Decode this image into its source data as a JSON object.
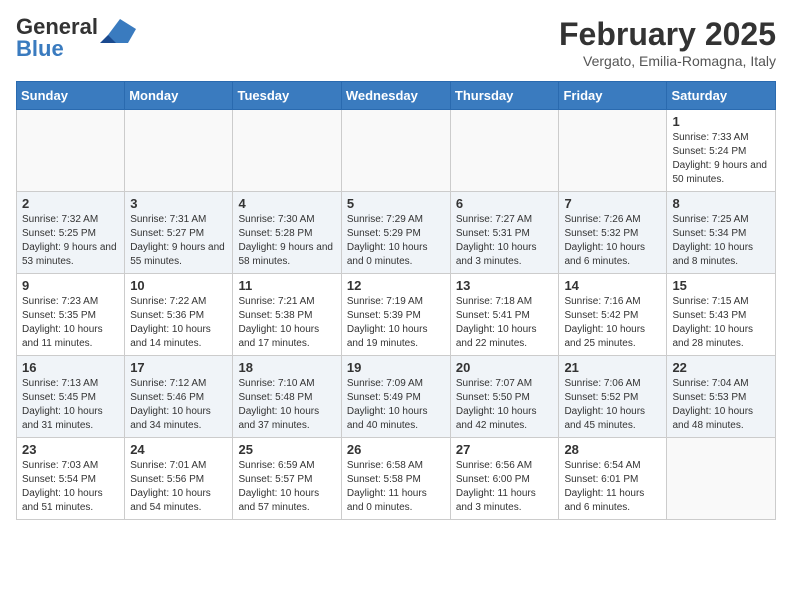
{
  "header": {
    "logo_general": "General",
    "logo_blue": "Blue",
    "month_year": "February 2025",
    "location": "Vergato, Emilia-Romagna, Italy"
  },
  "days_of_week": [
    "Sunday",
    "Monday",
    "Tuesday",
    "Wednesday",
    "Thursday",
    "Friday",
    "Saturday"
  ],
  "weeks": [
    {
      "alt": false,
      "days": [
        {
          "num": "",
          "info": ""
        },
        {
          "num": "",
          "info": ""
        },
        {
          "num": "",
          "info": ""
        },
        {
          "num": "",
          "info": ""
        },
        {
          "num": "",
          "info": ""
        },
        {
          "num": "",
          "info": ""
        },
        {
          "num": "1",
          "info": "Sunrise: 7:33 AM\nSunset: 5:24 PM\nDaylight: 9 hours and 50 minutes."
        }
      ]
    },
    {
      "alt": true,
      "days": [
        {
          "num": "2",
          "info": "Sunrise: 7:32 AM\nSunset: 5:25 PM\nDaylight: 9 hours and 53 minutes."
        },
        {
          "num": "3",
          "info": "Sunrise: 7:31 AM\nSunset: 5:27 PM\nDaylight: 9 hours and 55 minutes."
        },
        {
          "num": "4",
          "info": "Sunrise: 7:30 AM\nSunset: 5:28 PM\nDaylight: 9 hours and 58 minutes."
        },
        {
          "num": "5",
          "info": "Sunrise: 7:29 AM\nSunset: 5:29 PM\nDaylight: 10 hours and 0 minutes."
        },
        {
          "num": "6",
          "info": "Sunrise: 7:27 AM\nSunset: 5:31 PM\nDaylight: 10 hours and 3 minutes."
        },
        {
          "num": "7",
          "info": "Sunrise: 7:26 AM\nSunset: 5:32 PM\nDaylight: 10 hours and 6 minutes."
        },
        {
          "num": "8",
          "info": "Sunrise: 7:25 AM\nSunset: 5:34 PM\nDaylight: 10 hours and 8 minutes."
        }
      ]
    },
    {
      "alt": false,
      "days": [
        {
          "num": "9",
          "info": "Sunrise: 7:23 AM\nSunset: 5:35 PM\nDaylight: 10 hours and 11 minutes."
        },
        {
          "num": "10",
          "info": "Sunrise: 7:22 AM\nSunset: 5:36 PM\nDaylight: 10 hours and 14 minutes."
        },
        {
          "num": "11",
          "info": "Sunrise: 7:21 AM\nSunset: 5:38 PM\nDaylight: 10 hours and 17 minutes."
        },
        {
          "num": "12",
          "info": "Sunrise: 7:19 AM\nSunset: 5:39 PM\nDaylight: 10 hours and 19 minutes."
        },
        {
          "num": "13",
          "info": "Sunrise: 7:18 AM\nSunset: 5:41 PM\nDaylight: 10 hours and 22 minutes."
        },
        {
          "num": "14",
          "info": "Sunrise: 7:16 AM\nSunset: 5:42 PM\nDaylight: 10 hours and 25 minutes."
        },
        {
          "num": "15",
          "info": "Sunrise: 7:15 AM\nSunset: 5:43 PM\nDaylight: 10 hours and 28 minutes."
        }
      ]
    },
    {
      "alt": true,
      "days": [
        {
          "num": "16",
          "info": "Sunrise: 7:13 AM\nSunset: 5:45 PM\nDaylight: 10 hours and 31 minutes."
        },
        {
          "num": "17",
          "info": "Sunrise: 7:12 AM\nSunset: 5:46 PM\nDaylight: 10 hours and 34 minutes."
        },
        {
          "num": "18",
          "info": "Sunrise: 7:10 AM\nSunset: 5:48 PM\nDaylight: 10 hours and 37 minutes."
        },
        {
          "num": "19",
          "info": "Sunrise: 7:09 AM\nSunset: 5:49 PM\nDaylight: 10 hours and 40 minutes."
        },
        {
          "num": "20",
          "info": "Sunrise: 7:07 AM\nSunset: 5:50 PM\nDaylight: 10 hours and 42 minutes."
        },
        {
          "num": "21",
          "info": "Sunrise: 7:06 AM\nSunset: 5:52 PM\nDaylight: 10 hours and 45 minutes."
        },
        {
          "num": "22",
          "info": "Sunrise: 7:04 AM\nSunset: 5:53 PM\nDaylight: 10 hours and 48 minutes."
        }
      ]
    },
    {
      "alt": false,
      "days": [
        {
          "num": "23",
          "info": "Sunrise: 7:03 AM\nSunset: 5:54 PM\nDaylight: 10 hours and 51 minutes."
        },
        {
          "num": "24",
          "info": "Sunrise: 7:01 AM\nSunset: 5:56 PM\nDaylight: 10 hours and 54 minutes."
        },
        {
          "num": "25",
          "info": "Sunrise: 6:59 AM\nSunset: 5:57 PM\nDaylight: 10 hours and 57 minutes."
        },
        {
          "num": "26",
          "info": "Sunrise: 6:58 AM\nSunset: 5:58 PM\nDaylight: 11 hours and 0 minutes."
        },
        {
          "num": "27",
          "info": "Sunrise: 6:56 AM\nSunset: 6:00 PM\nDaylight: 11 hours and 3 minutes."
        },
        {
          "num": "28",
          "info": "Sunrise: 6:54 AM\nSunset: 6:01 PM\nDaylight: 11 hours and 6 minutes."
        },
        {
          "num": "",
          "info": ""
        }
      ]
    }
  ]
}
